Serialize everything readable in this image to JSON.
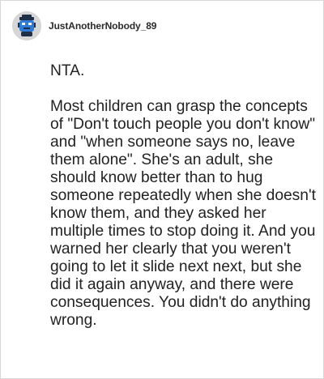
{
  "post": {
    "author": {
      "name": "JustAnotherNobody_89",
      "avatar_icon": "robot-avatar-icon"
    },
    "paragraphs": [
      "NTA.",
      "Most children can grasp the concepts of \"Don't touch people you don't know\" and \"when someone says no, leave them alone\". She's an adult, she should know better than to hug someone repeatedly when she doesn't know them, and they asked her multiple times to stop doing it. And you warned her clearly that you weren't going to let it slide next next, but she did it again anyway, and there were consequences. You didn't do anything wrong."
    ]
  },
  "colors": {
    "text": "#222222",
    "border": "#d8d8d8",
    "avatar_bg": "#d6d6d6",
    "avatar_dark": "#1f2f46",
    "avatar_blue": "#2d7bd6"
  }
}
